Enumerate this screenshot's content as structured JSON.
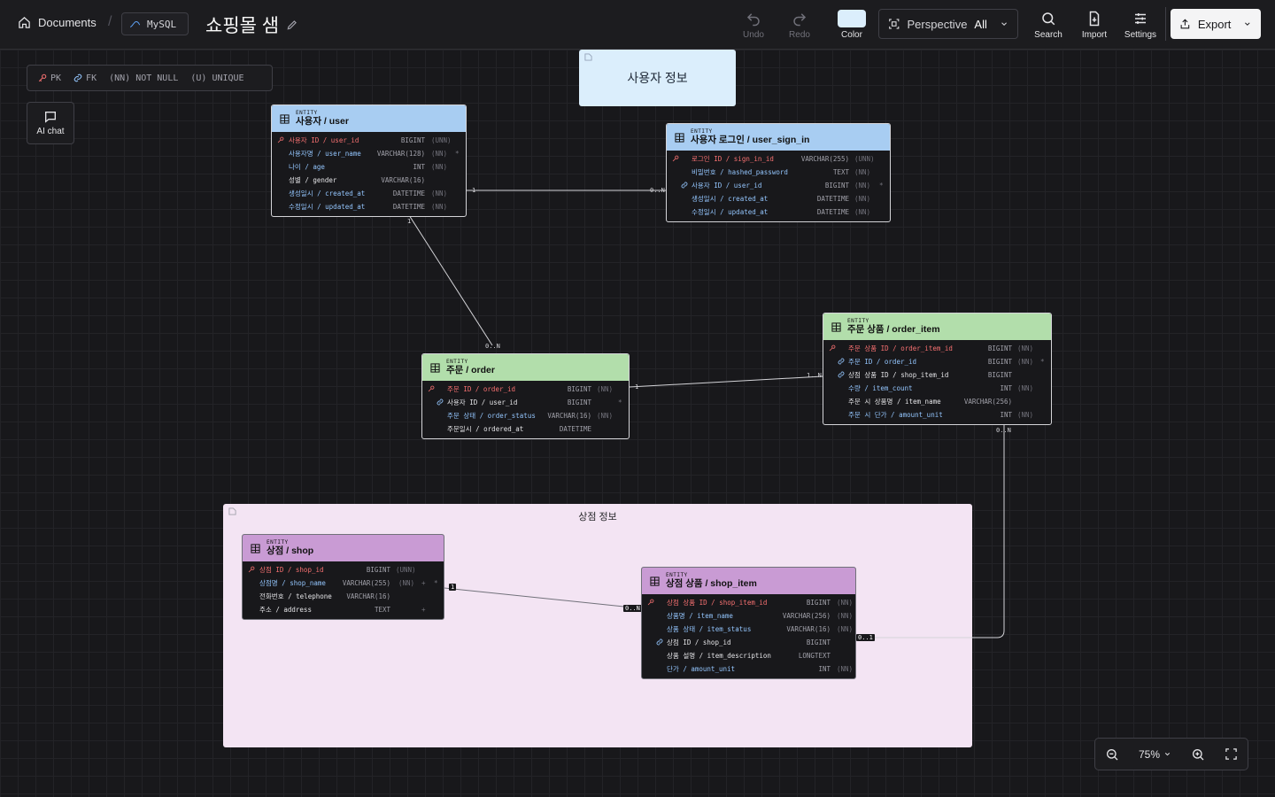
{
  "topbar": {
    "home_label": "Documents",
    "db_label": "MySQL",
    "title": "쇼핑몰 샘",
    "undo": "Undo",
    "redo": "Redo",
    "color": "Color",
    "color_value": "#dbeefc",
    "perspective": "Perspective",
    "perspective_value": "All",
    "search": "Search",
    "import": "Import",
    "settings": "Settings",
    "export": "Export"
  },
  "legend": {
    "pk": "PK",
    "fk": "FK",
    "nn": "(NN) NOT NULL",
    "u": "(U) UNIQUE"
  },
  "aichat": "AI chat",
  "groups": {
    "user_note": "사용자 정보",
    "shop_area": "상점 정보"
  },
  "entity_tag": "ENTITY",
  "entities": {
    "user": {
      "name": "사용자 / user",
      "rows": [
        {
          "col": "사용자 ID / user_id",
          "type": "BIGINT",
          "cons": "(UNN)"
        },
        {
          "col": "사용자명 / user_name",
          "type": "VARCHAR(128)",
          "cons": "(NN)"
        },
        {
          "col": "나이 / age",
          "type": "INT",
          "cons": "(NN)"
        },
        {
          "col": "성별 / gender",
          "type": "VARCHAR(16)",
          "cons": ""
        },
        {
          "col": "생성일시 / created_at",
          "type": "DATETIME",
          "cons": "(NN)"
        },
        {
          "col": "수정일시 / updated_at",
          "type": "DATETIME",
          "cons": "(NN)"
        }
      ]
    },
    "user_sign_in": {
      "name": "사용자 로그인 / user_sign_in",
      "rows": [
        {
          "col": "로그인 ID / sign_in_id",
          "type": "VARCHAR(255)",
          "cons": "(UNN)"
        },
        {
          "col": "비밀번호 / hashed_password",
          "type": "TEXT",
          "cons": "(NN)"
        },
        {
          "col": "사용자 ID / user_id",
          "type": "BIGINT",
          "cons": "(NN)"
        },
        {
          "col": "생성일시 / created_at",
          "type": "DATETIME",
          "cons": "(NN)"
        },
        {
          "col": "수정일시 / updated_at",
          "type": "DATETIME",
          "cons": "(NN)"
        }
      ]
    },
    "order": {
      "name": "주문 / order",
      "rows": [
        {
          "col": "주문 ID / order_id",
          "type": "BIGINT",
          "cons": "(NN)"
        },
        {
          "col": "사용자 ID / user_id",
          "type": "BIGINT",
          "cons": ""
        },
        {
          "col": "주문 상태 / order_status",
          "type": "VARCHAR(16)",
          "cons": "(NN)"
        },
        {
          "col": "주문일시 / ordered_at",
          "type": "DATETIME",
          "cons": ""
        }
      ]
    },
    "order_item": {
      "name": "주문 상품 / order_item",
      "rows": [
        {
          "col": "주문 상품 ID / order_item_id",
          "type": "BIGINT",
          "cons": "(NN)"
        },
        {
          "col": "주문 ID / order_id",
          "type": "BIGINT",
          "cons": "(NN)"
        },
        {
          "col": "상점 상품 ID / shop_item_id",
          "type": "BIGINT",
          "cons": ""
        },
        {
          "col": "수량 / item_count",
          "type": "INT",
          "cons": "(NN)"
        },
        {
          "col": "주문 시 상품명 / item_name",
          "type": "VARCHAR(256)",
          "cons": ""
        },
        {
          "col": "주문 시 단가 / amount_unit",
          "type": "INT",
          "cons": "(NN)"
        }
      ]
    },
    "shop": {
      "name": "상점 / shop",
      "rows": [
        {
          "col": "상점 ID / shop_id",
          "type": "BIGINT",
          "cons": "(UNN)"
        },
        {
          "col": "상점명 / shop_name",
          "type": "VARCHAR(255)",
          "cons": "(NN)"
        },
        {
          "col": "전화번호 / telephone",
          "type": "VARCHAR(16)",
          "cons": ""
        },
        {
          "col": "주소 / address",
          "type": "TEXT",
          "cons": ""
        }
      ]
    },
    "shop_item": {
      "name": "상점 상품 / shop_item",
      "rows": [
        {
          "col": "상점 상품 ID / shop_item_id",
          "type": "BIGINT",
          "cons": "(NN)"
        },
        {
          "col": "상품명 / item_name",
          "type": "VARCHAR(256)",
          "cons": "(NN)"
        },
        {
          "col": "상품 상태 / item_status",
          "type": "VARCHAR(16)",
          "cons": "(NN)"
        },
        {
          "col": "상점 ID / shop_id",
          "type": "BIGINT",
          "cons": ""
        },
        {
          "col": "상품 설명 / item_description",
          "type": "LONGTEXT",
          "cons": ""
        },
        {
          "col": "단가 / amount_unit",
          "type": "INT",
          "cons": "(NN)"
        }
      ]
    }
  },
  "cardinality": {
    "user_signin_a": "1",
    "user_signin_b": "0..N",
    "user_order_a": "1",
    "user_order_b": "0..N",
    "order_item_a": "1",
    "order_item_b": "1..N",
    "orderitem_shopitem_a": "0..N",
    "orderitem_shopitem_b": "0..1",
    "shop_item_a": "1",
    "shop_item_b": "0..N"
  },
  "zoom": {
    "level": "75%"
  }
}
